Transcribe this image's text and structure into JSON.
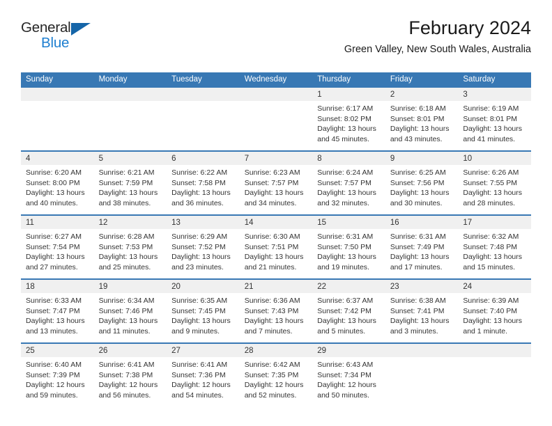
{
  "brand": {
    "name_part1": "General",
    "name_part2": "Blue",
    "flag_color": "#1565a8",
    "blue_color": "#1f7fd0"
  },
  "header": {
    "title": "February 2024",
    "subtitle": "Green Valley, New South Wales, Australia"
  },
  "theme": {
    "header_bg": "#3878b4",
    "header_text": "#ffffff",
    "daynum_bg": "#f0f0f0",
    "body_bg": "#ffffff",
    "text": "#333333"
  },
  "calendar": {
    "weekday_headers": [
      "Sunday",
      "Monday",
      "Tuesday",
      "Wednesday",
      "Thursday",
      "Friday",
      "Saturday"
    ],
    "weeks": [
      [
        {
          "day": "",
          "empty": true,
          "line1": "",
          "line2": "",
          "line3": "",
          "line4": ""
        },
        {
          "day": "",
          "empty": true,
          "line1": "",
          "line2": "",
          "line3": "",
          "line4": ""
        },
        {
          "day": "",
          "empty": true,
          "line1": "",
          "line2": "",
          "line3": "",
          "line4": ""
        },
        {
          "day": "",
          "empty": true,
          "line1": "",
          "line2": "",
          "line3": "",
          "line4": ""
        },
        {
          "day": "1",
          "empty": false,
          "line1": "Sunrise: 6:17 AM",
          "line2": "Sunset: 8:02 PM",
          "line3": "Daylight: 13 hours",
          "line4": "and 45 minutes."
        },
        {
          "day": "2",
          "empty": false,
          "line1": "Sunrise: 6:18 AM",
          "line2": "Sunset: 8:01 PM",
          "line3": "Daylight: 13 hours",
          "line4": "and 43 minutes."
        },
        {
          "day": "3",
          "empty": false,
          "line1": "Sunrise: 6:19 AM",
          "line2": "Sunset: 8:01 PM",
          "line3": "Daylight: 13 hours",
          "line4": "and 41 minutes."
        }
      ],
      [
        {
          "day": "4",
          "empty": false,
          "line1": "Sunrise: 6:20 AM",
          "line2": "Sunset: 8:00 PM",
          "line3": "Daylight: 13 hours",
          "line4": "and 40 minutes."
        },
        {
          "day": "5",
          "empty": false,
          "line1": "Sunrise: 6:21 AM",
          "line2": "Sunset: 7:59 PM",
          "line3": "Daylight: 13 hours",
          "line4": "and 38 minutes."
        },
        {
          "day": "6",
          "empty": false,
          "line1": "Sunrise: 6:22 AM",
          "line2": "Sunset: 7:58 PM",
          "line3": "Daylight: 13 hours",
          "line4": "and 36 minutes."
        },
        {
          "day": "7",
          "empty": false,
          "line1": "Sunrise: 6:23 AM",
          "line2": "Sunset: 7:57 PM",
          "line3": "Daylight: 13 hours",
          "line4": "and 34 minutes."
        },
        {
          "day": "8",
          "empty": false,
          "line1": "Sunrise: 6:24 AM",
          "line2": "Sunset: 7:57 PM",
          "line3": "Daylight: 13 hours",
          "line4": "and 32 minutes."
        },
        {
          "day": "9",
          "empty": false,
          "line1": "Sunrise: 6:25 AM",
          "line2": "Sunset: 7:56 PM",
          "line3": "Daylight: 13 hours",
          "line4": "and 30 minutes."
        },
        {
          "day": "10",
          "empty": false,
          "line1": "Sunrise: 6:26 AM",
          "line2": "Sunset: 7:55 PM",
          "line3": "Daylight: 13 hours",
          "line4": "and 28 minutes."
        }
      ],
      [
        {
          "day": "11",
          "empty": false,
          "line1": "Sunrise: 6:27 AM",
          "line2": "Sunset: 7:54 PM",
          "line3": "Daylight: 13 hours",
          "line4": "and 27 minutes."
        },
        {
          "day": "12",
          "empty": false,
          "line1": "Sunrise: 6:28 AM",
          "line2": "Sunset: 7:53 PM",
          "line3": "Daylight: 13 hours",
          "line4": "and 25 minutes."
        },
        {
          "day": "13",
          "empty": false,
          "line1": "Sunrise: 6:29 AM",
          "line2": "Sunset: 7:52 PM",
          "line3": "Daylight: 13 hours",
          "line4": "and 23 minutes."
        },
        {
          "day": "14",
          "empty": false,
          "line1": "Sunrise: 6:30 AM",
          "line2": "Sunset: 7:51 PM",
          "line3": "Daylight: 13 hours",
          "line4": "and 21 minutes."
        },
        {
          "day": "15",
          "empty": false,
          "line1": "Sunrise: 6:31 AM",
          "line2": "Sunset: 7:50 PM",
          "line3": "Daylight: 13 hours",
          "line4": "and 19 minutes."
        },
        {
          "day": "16",
          "empty": false,
          "line1": "Sunrise: 6:31 AM",
          "line2": "Sunset: 7:49 PM",
          "line3": "Daylight: 13 hours",
          "line4": "and 17 minutes."
        },
        {
          "day": "17",
          "empty": false,
          "line1": "Sunrise: 6:32 AM",
          "line2": "Sunset: 7:48 PM",
          "line3": "Daylight: 13 hours",
          "line4": "and 15 minutes."
        }
      ],
      [
        {
          "day": "18",
          "empty": false,
          "line1": "Sunrise: 6:33 AM",
          "line2": "Sunset: 7:47 PM",
          "line3": "Daylight: 13 hours",
          "line4": "and 13 minutes."
        },
        {
          "day": "19",
          "empty": false,
          "line1": "Sunrise: 6:34 AM",
          "line2": "Sunset: 7:46 PM",
          "line3": "Daylight: 13 hours",
          "line4": "and 11 minutes."
        },
        {
          "day": "20",
          "empty": false,
          "line1": "Sunrise: 6:35 AM",
          "line2": "Sunset: 7:45 PM",
          "line3": "Daylight: 13 hours",
          "line4": "and 9 minutes."
        },
        {
          "day": "21",
          "empty": false,
          "line1": "Sunrise: 6:36 AM",
          "line2": "Sunset: 7:43 PM",
          "line3": "Daylight: 13 hours",
          "line4": "and 7 minutes."
        },
        {
          "day": "22",
          "empty": false,
          "line1": "Sunrise: 6:37 AM",
          "line2": "Sunset: 7:42 PM",
          "line3": "Daylight: 13 hours",
          "line4": "and 5 minutes."
        },
        {
          "day": "23",
          "empty": false,
          "line1": "Sunrise: 6:38 AM",
          "line2": "Sunset: 7:41 PM",
          "line3": "Daylight: 13 hours",
          "line4": "and 3 minutes."
        },
        {
          "day": "24",
          "empty": false,
          "line1": "Sunrise: 6:39 AM",
          "line2": "Sunset: 7:40 PM",
          "line3": "Daylight: 13 hours",
          "line4": "and 1 minute."
        }
      ],
      [
        {
          "day": "25",
          "empty": false,
          "line1": "Sunrise: 6:40 AM",
          "line2": "Sunset: 7:39 PM",
          "line3": "Daylight: 12 hours",
          "line4": "and 59 minutes."
        },
        {
          "day": "26",
          "empty": false,
          "line1": "Sunrise: 6:41 AM",
          "line2": "Sunset: 7:38 PM",
          "line3": "Daylight: 12 hours",
          "line4": "and 56 minutes."
        },
        {
          "day": "27",
          "empty": false,
          "line1": "Sunrise: 6:41 AM",
          "line2": "Sunset: 7:36 PM",
          "line3": "Daylight: 12 hours",
          "line4": "and 54 minutes."
        },
        {
          "day": "28",
          "empty": false,
          "line1": "Sunrise: 6:42 AM",
          "line2": "Sunset: 7:35 PM",
          "line3": "Daylight: 12 hours",
          "line4": "and 52 minutes."
        },
        {
          "day": "29",
          "empty": false,
          "line1": "Sunrise: 6:43 AM",
          "line2": "Sunset: 7:34 PM",
          "line3": "Daylight: 12 hours",
          "line4": "and 50 minutes."
        },
        {
          "day": "",
          "empty": true,
          "line1": "",
          "line2": "",
          "line3": "",
          "line4": ""
        },
        {
          "day": "",
          "empty": true,
          "line1": "",
          "line2": "",
          "line3": "",
          "line4": ""
        }
      ]
    ]
  }
}
